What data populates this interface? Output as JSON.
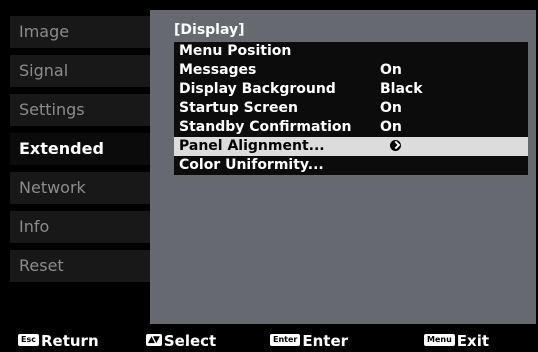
{
  "sidebar": {
    "items": [
      {
        "label": "Image"
      },
      {
        "label": "Signal"
      },
      {
        "label": "Settings"
      },
      {
        "label": "Extended"
      },
      {
        "label": "Network"
      },
      {
        "label": "Info"
      },
      {
        "label": "Reset"
      }
    ],
    "active": "Extended"
  },
  "panel": {
    "title": "[Display]",
    "rows": [
      {
        "label": "Menu Position",
        "value": ""
      },
      {
        "label": "Messages",
        "value": "On"
      },
      {
        "label": "Display Background",
        "value": "Black"
      },
      {
        "label": "Startup Screen",
        "value": "On"
      },
      {
        "label": "Standby Confirmation",
        "value": "On"
      },
      {
        "label": "Panel Alignment...",
        "value": ""
      },
      {
        "label": "Color Uniformity...",
        "value": ""
      }
    ],
    "selected": "Panel Alignment...",
    "cursor_icon": "enter-cursor-icon"
  },
  "footer": {
    "hints": [
      {
        "key": "Esc",
        "label": "Return"
      },
      {
        "key": "▲▼",
        "label": "Select"
      },
      {
        "key": "Enter",
        "label": "Enter"
      },
      {
        "key": "Menu",
        "label": "Exit"
      }
    ]
  },
  "colors": {
    "panel_bg": "#666a70",
    "row_bg": "#0c0c0c",
    "selected_row_bg": "#dcdcdc",
    "sidebar_bg": "#181818",
    "sidebar_text": "#8c8c8c"
  }
}
